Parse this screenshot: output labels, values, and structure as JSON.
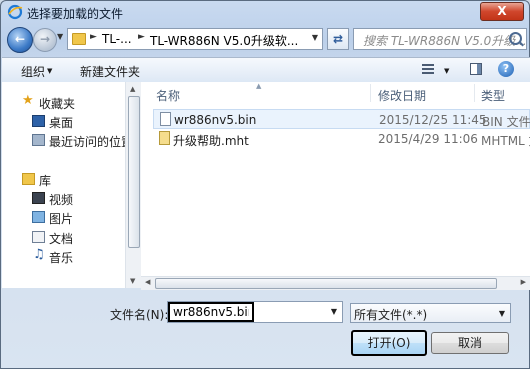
{
  "window": {
    "title": "选择要加载的文件",
    "close_label": "X"
  },
  "navigation": {
    "breadcrumb": [
      "TL-...",
      "TL-WR886N V5.0升级软..."
    ],
    "search_placeholder": "搜索 TL-WR886N V5.0升级..."
  },
  "toolbar": {
    "organize_label": "组织",
    "new_folder_label": "新建文件夹"
  },
  "sidebar": {
    "favorites_header": "收藏夹",
    "favorites": [
      {
        "label": "桌面",
        "icon": "desktop-icon"
      },
      {
        "label": "最近访问的位置",
        "icon": "recent-places-icon"
      }
    ],
    "libraries_header": "库",
    "libraries": [
      {
        "label": "视频",
        "icon": "video-icon"
      },
      {
        "label": "图片",
        "icon": "pictures-icon"
      },
      {
        "label": "文档",
        "icon": "documents-icon"
      },
      {
        "label": "音乐",
        "icon": "music-icon"
      }
    ]
  },
  "file_list": {
    "columns": [
      "名称",
      "修改日期",
      "类型"
    ],
    "rows": [
      {
        "name": "wr886nv5.bin",
        "modified": "2015/12/25 11:45",
        "type": "BIN 文件",
        "selected": true
      },
      {
        "name": "升级帮助.mht",
        "modified": "2015/4/29 11:06",
        "type": "MHTML 文",
        "selected": false
      }
    ]
  },
  "footer": {
    "filename_label": "文件名(N):",
    "filename_value": "wr886nv5.bin",
    "filetype_value": "所有文件(*.*)",
    "open_label": "打开(O)",
    "cancel_label": "取消"
  }
}
